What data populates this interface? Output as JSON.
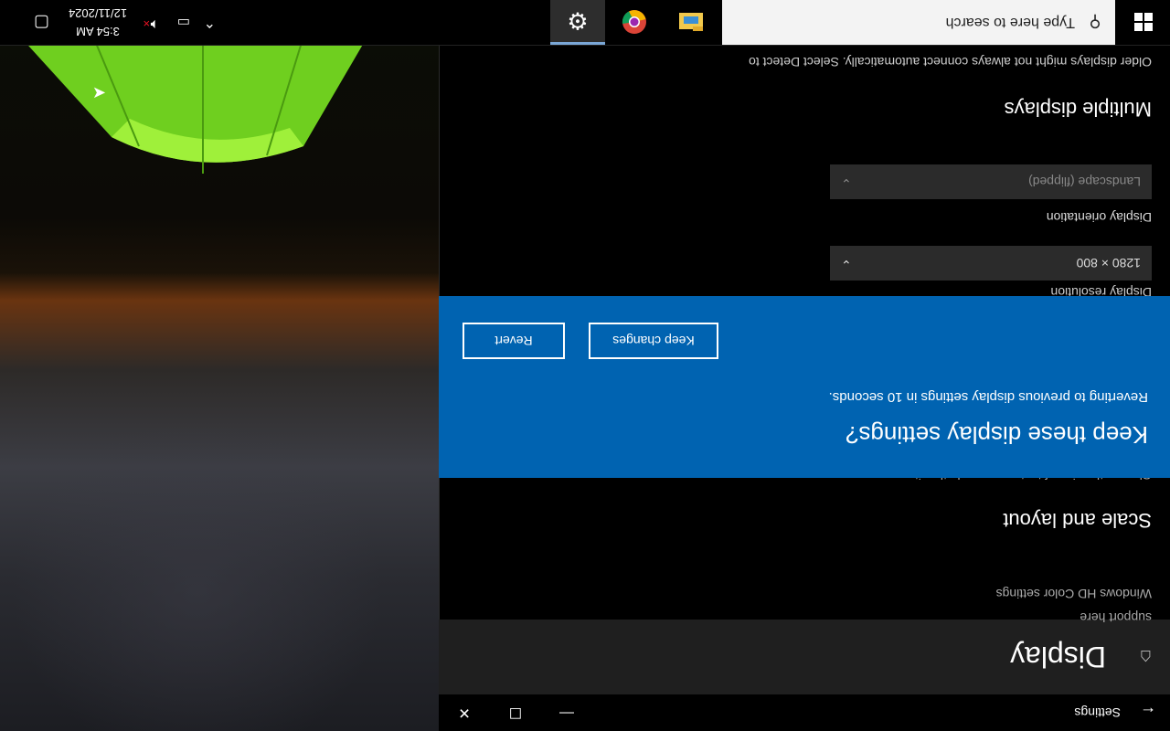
{
  "window": {
    "title": "Settings",
    "back_icon": "back-arrow-icon",
    "minimize_glyph": "—",
    "maximize_glyph": "☐",
    "close_glyph": "✕"
  },
  "page": {
    "icon": "home-icon",
    "title": "Display",
    "support_text": "support here",
    "hdr_link": "Windows HD Color settings",
    "scale_heading": "Scale and layout",
    "scale_desc": "Change the size of text, apps, and other items"
  },
  "dialog": {
    "title": "Keep these display settings?",
    "message": "Reverting to previous display settings in 10 seconds.",
    "keep_label": "Keep changes",
    "revert_label": "Revert",
    "background": "#0063b1"
  },
  "resolution": {
    "label": "Display resolution",
    "value": "1280 × 800"
  },
  "orientation": {
    "label": "Display orientation",
    "value": "Landscape (flipped)"
  },
  "multiple": {
    "heading": "Multiple displays",
    "desc": "Older displays might not always connect automatically. Select Detect to"
  },
  "taskbar": {
    "search_placeholder": "Type here to search",
    "apps": [
      "file-explorer-icon",
      "chrome-icon",
      "settings-gear-icon"
    ],
    "clock_time": "3:54 AM",
    "clock_date": "12/11/2024",
    "tray_chevron": "⌃"
  }
}
